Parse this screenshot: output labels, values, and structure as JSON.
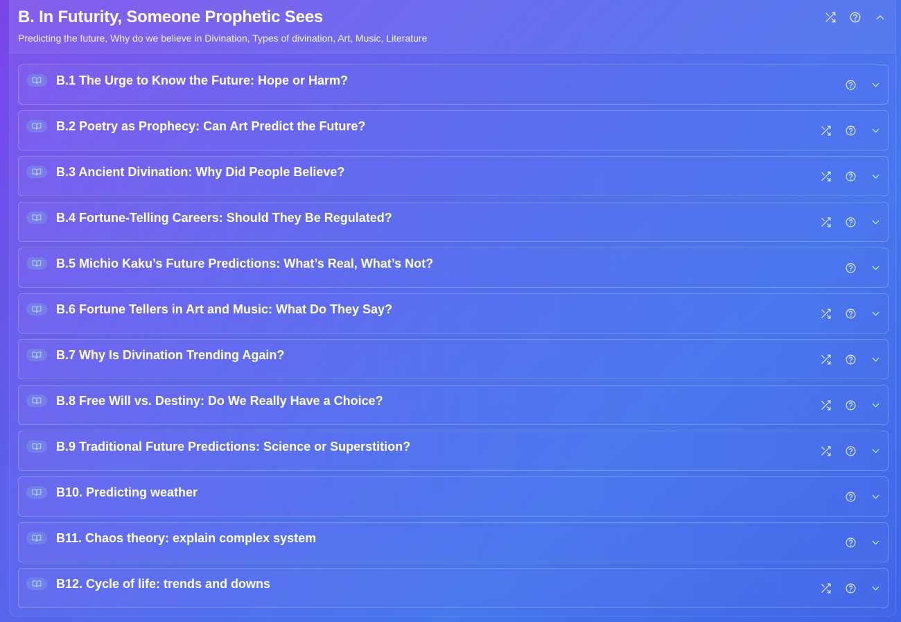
{
  "section": {
    "title": "B. In Futurity, Someone Prophetic Sees",
    "subtitle": "Predicting the future, Why do we believe in Divination, Types of divination, Art, Music, Literature"
  },
  "icons": {
    "shuffle": "shuffle-icon",
    "help": "help-circle-icon",
    "collapse": "chevron-up-icon",
    "expand": "chevron-down-icon",
    "book": "book-open-icon"
  },
  "items": [
    {
      "title": "B.1 The Urge to Know the Future: Hope or Harm?",
      "shuffle": false
    },
    {
      "title": "B.2 Poetry as Prophecy: Can Art Predict the Future?",
      "shuffle": true
    },
    {
      "title": "B.3 Ancient Divination: Why Did People Believe?",
      "shuffle": true
    },
    {
      "title": "B.4 Fortune-Telling Careers: Should They Be Regulated?",
      "shuffle": true
    },
    {
      "title": "B.5 Michio Kaku’s Future Predictions: What’s Real, What’s Not?",
      "shuffle": false
    },
    {
      "title": "B.6 Fortune Tellers in Art and Music: What Do They Say?",
      "shuffle": true
    },
    {
      "title": "B.7 Why Is Divination Trending Again?",
      "shuffle": true
    },
    {
      "title": "B.8 Free Will vs. Destiny: Do We Really Have a Choice?",
      "shuffle": true
    },
    {
      "title": "B.9 Traditional Future Predictions: Science or Superstition?",
      "shuffle": true
    },
    {
      "title": "B10. Predicting weather",
      "shuffle": false
    },
    {
      "title": "B11. Chaos theory: explain complex system",
      "shuffle": false
    },
    {
      "title": "B12. Cycle of life: trends and downs",
      "shuffle": true
    }
  ]
}
